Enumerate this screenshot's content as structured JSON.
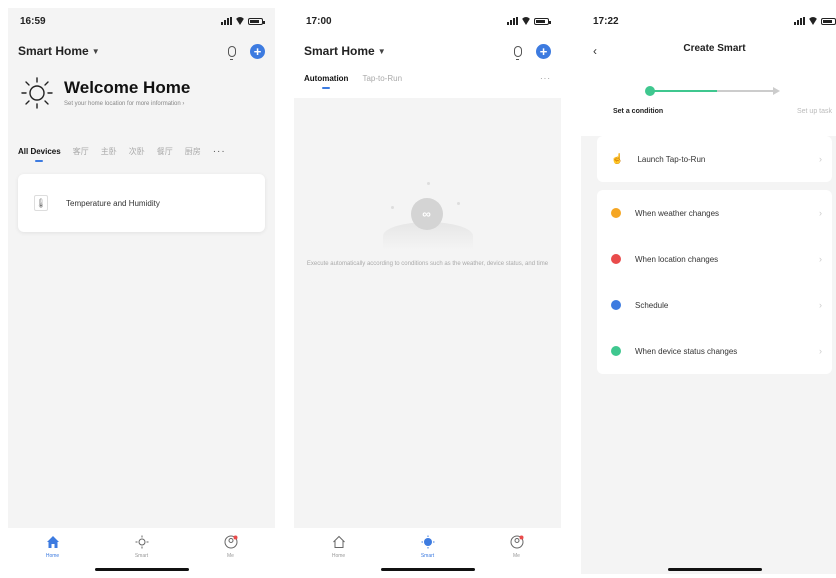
{
  "screen1": {
    "status_time": "16:59",
    "home_name": "Smart Home",
    "welcome_title": "Welcome Home",
    "welcome_subtitle": "Set your home location for more information",
    "rooms": [
      "All Devices",
      "客厅",
      "主卧",
      "次卧",
      "餐厅",
      "厨房"
    ],
    "device_name": "Temperature and Humidity",
    "tabs": [
      "Home",
      "Smart",
      "Me"
    ]
  },
  "screen2": {
    "status_time": "17:00",
    "home_name": "Smart Home",
    "subtabs": [
      "Automation",
      "Tap-to-Run"
    ],
    "empty_text": "Execute automatically according to conditions such as the weather, device status, and time",
    "tabs": [
      "Home",
      "Smart",
      "Me"
    ]
  },
  "screen3": {
    "status_time": "17:22",
    "title": "Create Smart",
    "step1": "Set a condition",
    "step2": "Set up task",
    "launch_label": "Launch Tap-to-Run",
    "conditions": [
      {
        "label": "When weather changes",
        "color": "#f5a623"
      },
      {
        "label": "When location changes",
        "color": "#e94b4b"
      },
      {
        "label": "Schedule",
        "color": "#3d7be0"
      },
      {
        "label": "When device status changes",
        "color": "#3fc78f"
      }
    ]
  },
  "colors": {
    "accent": "#3d7be0",
    "success": "#3fc78f"
  }
}
